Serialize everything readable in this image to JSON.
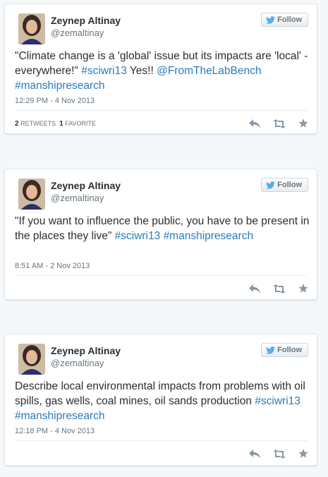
{
  "tweets": [
    {
      "author_name": "Zeynep Altinay",
      "author_handle": "@zemaltinay",
      "follow_label": "Follow",
      "text_parts": [
        "\"Climate change is a 'global' issue but its impacts are 'local' - everywhere!\" ",
        "#sciwri13",
        " Yes!! ",
        "@FromTheLabBench",
        " ",
        "#manshipresearch"
      ],
      "timestamp": "12:29 PM - 4 Nov 2013",
      "retweets_count": "2",
      "retweets_label": "RETWEETS",
      "favorites_count": "1",
      "favorites_label": "FAVORITE"
    },
    {
      "author_name": "Zeynep Altinay",
      "author_handle": "@zemaltinay",
      "follow_label": "Follow",
      "text_parts": [
        "\"If you want to influence the public, you have to be present in the places they live\" ",
        "#sciwri13",
        " ",
        "#manshipresearch"
      ],
      "timestamp": "8:51 AM - 2 Nov 2013"
    },
    {
      "author_name": "Zeynep Altinay",
      "author_handle": "@zemaltinay",
      "follow_label": "Follow",
      "text_parts": [
        "Describe local environmental impacts from problems with oil spills, gas wells, coal mines, oil sands production ",
        "#sciwri13",
        " ",
        "#manshipresearch"
      ],
      "timestamp": "12:18 PM - 4 Nov 2013"
    }
  ],
  "colors": {
    "link": "#2b7bb9",
    "text": "#292f33",
    "muted": "#66757f",
    "twitter_bird": "#55acee",
    "action_icon": "#8899a6"
  },
  "icons": {
    "follow_bird": "twitter-bird-icon",
    "reply": "reply-icon",
    "retweet": "retweet-icon",
    "favorite": "star-icon"
  }
}
